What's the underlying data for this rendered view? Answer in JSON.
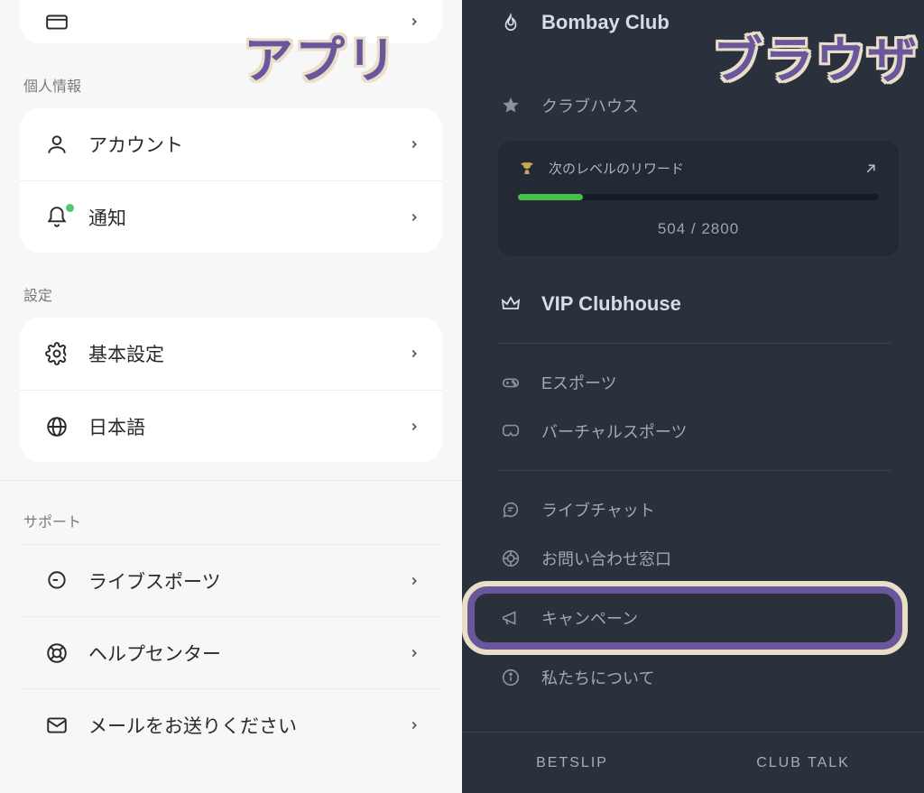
{
  "overlay": {
    "app_tag": "アプリ",
    "browser_tag": "ブラウザ"
  },
  "app": {
    "sections": {
      "personal_info_header": "個人情報",
      "settings_header": "設定",
      "support_header": "サポート"
    },
    "items": {
      "account": "アカウント",
      "notifications": "通知",
      "preferences": "基本設定",
      "language": "日本語",
      "live_sports": "ライブスポーツ",
      "help_center": "ヘルプセンター",
      "email_us": "メールをお送りください"
    }
  },
  "browser": {
    "items": {
      "bombay": "Bombay Club",
      "clubhouse": "クラブハウス",
      "vip_clubhouse": "VIP Clubhouse",
      "esports": "Eスポーツ",
      "virtual_sports": "バーチャルスポーツ",
      "live_chat": "ライブチャット",
      "contact": "お問い合わせ窓口",
      "campaign": "キャンペーン",
      "about": "私たちについて"
    },
    "reward": {
      "label": "次のレベルのリワード",
      "progress_current": 504,
      "progress_max": 2800,
      "progress_text": "504 / 2800",
      "progress_pct": 18
    },
    "bottom": {
      "betslip": "BETSLIP",
      "clubtalk": "CLUB TALK"
    }
  },
  "colors": {
    "highlight": "#6a569a",
    "dark_bg": "#2a303c",
    "progress_green": "#46c04a"
  }
}
